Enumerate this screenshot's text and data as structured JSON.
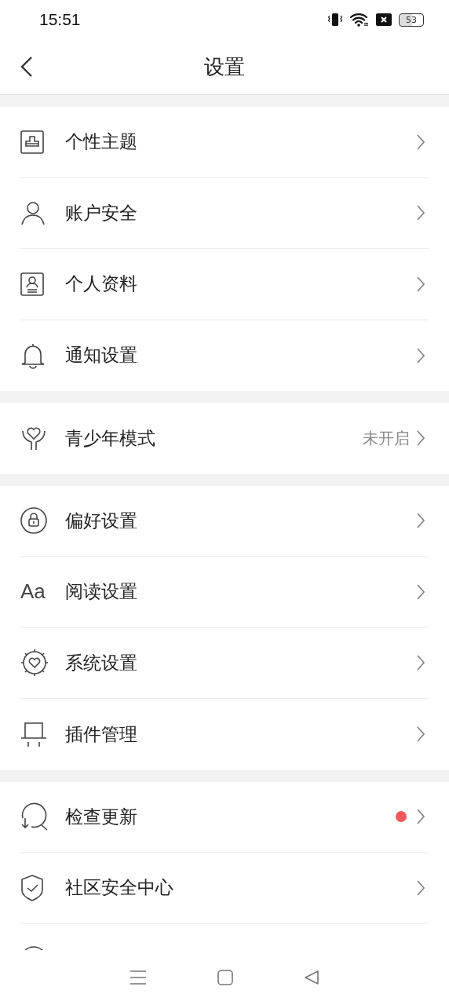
{
  "status_bar": {
    "time": "15:51",
    "battery": "53"
  },
  "header": {
    "title": "设置"
  },
  "groups": [
    {
      "items": [
        {
          "kind": "theme",
          "label": "个性主题"
        },
        {
          "kind": "person",
          "label": "账户安全"
        },
        {
          "kind": "profile",
          "label": "个人资料"
        },
        {
          "kind": "bell",
          "label": "通知设置"
        }
      ]
    },
    {
      "items": [
        {
          "kind": "heart-hands",
          "label": "青少年模式",
          "value": "未开启"
        }
      ]
    },
    {
      "items": [
        {
          "kind": "lock",
          "label": "偏好设置"
        },
        {
          "kind": "font",
          "label": "阅读设置",
          "icon_text": "Aa"
        },
        {
          "kind": "gear-heart",
          "label": "系统设置"
        },
        {
          "kind": "plugin",
          "label": "插件管理"
        }
      ]
    },
    {
      "items": [
        {
          "kind": "update",
          "label": "检查更新",
          "badge_dot": true,
          "color": "#f05a5a"
        },
        {
          "kind": "shield",
          "label": "社区安全中心"
        },
        {
          "kind": "circle"
        }
      ]
    }
  ]
}
